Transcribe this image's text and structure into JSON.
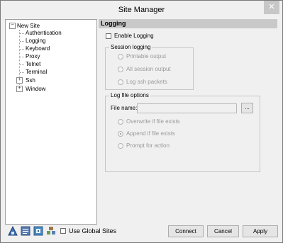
{
  "window": {
    "title": "Site Manager",
    "close_glyph": "✕"
  },
  "tree": {
    "root": {
      "label": "New Site",
      "toggle": "−"
    },
    "children": [
      {
        "label": "Authentication"
      },
      {
        "label": "Logging"
      },
      {
        "label": "Keyboard"
      },
      {
        "label": "Proxy"
      },
      {
        "label": "Telnet"
      },
      {
        "label": "Terminal"
      },
      {
        "label": "Ssh",
        "toggle": "+"
      },
      {
        "label": "Window",
        "toggle": "+"
      }
    ]
  },
  "panel": {
    "header": "Logging",
    "enable_logging": {
      "label": "Enable Logging",
      "checked": false
    },
    "session_logging": {
      "label": "Session logging",
      "options": [
        {
          "label": "Printable output",
          "selected": false
        },
        {
          "label": "All session output",
          "selected": false
        },
        {
          "label": "Log ssh packets",
          "selected": false
        }
      ]
    },
    "log_file_options": {
      "label": "Log file options",
      "file_name_label": "File name:",
      "file_name_value": "",
      "browse_label": "...",
      "options": [
        {
          "label": "Overwrite if file exists",
          "selected": false
        },
        {
          "label": "Append if file exists",
          "selected": true
        },
        {
          "label": "Prompt for action",
          "selected": false
        }
      ]
    }
  },
  "bottom": {
    "toolbar_icons": [
      "triangle-tool-icon",
      "document-icon",
      "connect-icon",
      "network-icon"
    ],
    "use_global_sites": {
      "label": "Use Global Sites",
      "checked": false
    },
    "buttons": {
      "connect": "Connect",
      "cancel": "Cancel",
      "apply": "Apply"
    }
  },
  "colors": {
    "header_bg": "#c9c9c9",
    "close_bg": "#c7c7c7",
    "window_bg": "#f0f0f0"
  }
}
